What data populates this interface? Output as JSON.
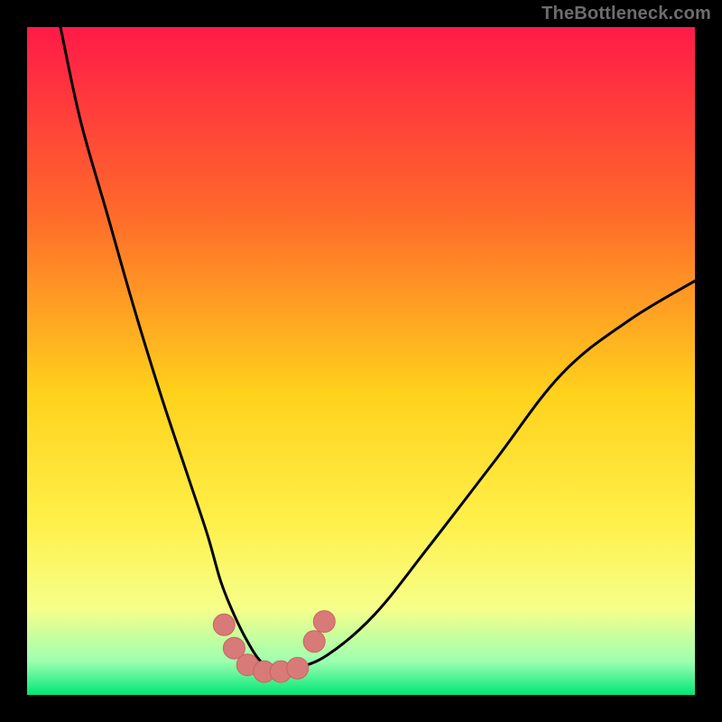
{
  "watermark": "TheBottleneck.com",
  "colors": {
    "frame": "#000000",
    "grad_top": "#ff1a48",
    "grad_mid1": "#ff6a2a",
    "grad_mid2": "#ffd21c",
    "grad_mid3": "#fff04a",
    "grad_mid4": "#f6ff8a",
    "grad_bot1": "#9dffb0",
    "grad_bot2": "#00e676",
    "curve": "#000000",
    "marker_fill": "#d87a78",
    "marker_stroke": "#c96462"
  },
  "chart_data": {
    "type": "line",
    "title": "",
    "xlabel": "",
    "ylabel": "",
    "xlim": [
      0,
      100
    ],
    "ylim": [
      0,
      100
    ],
    "series": [
      {
        "name": "bottleneck-curve",
        "x": [
          5,
          8,
          12,
          16,
          20,
          24,
          27,
          29,
          31,
          33,
          35,
          37,
          40,
          45,
          52,
          60,
          70,
          80,
          90,
          100
        ],
        "y": [
          100,
          86,
          72,
          58,
          45,
          33,
          24,
          17,
          12,
          8,
          5,
          4,
          4,
          6,
          12,
          22,
          35,
          48,
          56,
          62
        ]
      }
    ],
    "markers": [
      {
        "x": 29.5,
        "y": 10.5
      },
      {
        "x": 31.0,
        "y": 7.0
      },
      {
        "x": 33.0,
        "y": 4.5
      },
      {
        "x": 35.5,
        "y": 3.5
      },
      {
        "x": 38.0,
        "y": 3.5
      },
      {
        "x": 40.5,
        "y": 4.0
      },
      {
        "x": 43.0,
        "y": 8.0
      },
      {
        "x": 44.5,
        "y": 11.0
      }
    ],
    "marker_radius_px": 12
  }
}
